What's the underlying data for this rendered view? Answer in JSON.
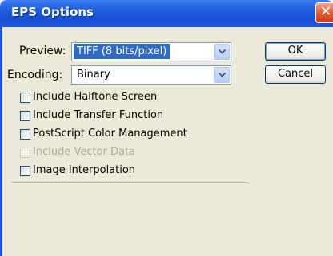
{
  "window": {
    "title": "EPS Options",
    "close_glyph": "✕"
  },
  "preview": {
    "label": "Preview:",
    "value": "TIFF  (8 bits/pixel)"
  },
  "encoding": {
    "label": "Encoding:",
    "value": "Binary"
  },
  "options": [
    {
      "label": "Include Halftone Screen",
      "checked": false,
      "disabled": false
    },
    {
      "label": "Include Transfer Function",
      "checked": false,
      "disabled": false
    },
    {
      "label": "PostScript Color Management",
      "checked": false,
      "disabled": false
    },
    {
      "label": "Include Vector Data",
      "checked": false,
      "disabled": true
    },
    {
      "label": "Image Interpolation",
      "checked": false,
      "disabled": false
    }
  ],
  "buttons": {
    "ok": "OK",
    "cancel": "Cancel"
  },
  "colors": {
    "titlebar": "#1f5fe0",
    "dialog_bg": "#ece9d8",
    "selection": "#316ac5",
    "close": "#e4532f"
  }
}
